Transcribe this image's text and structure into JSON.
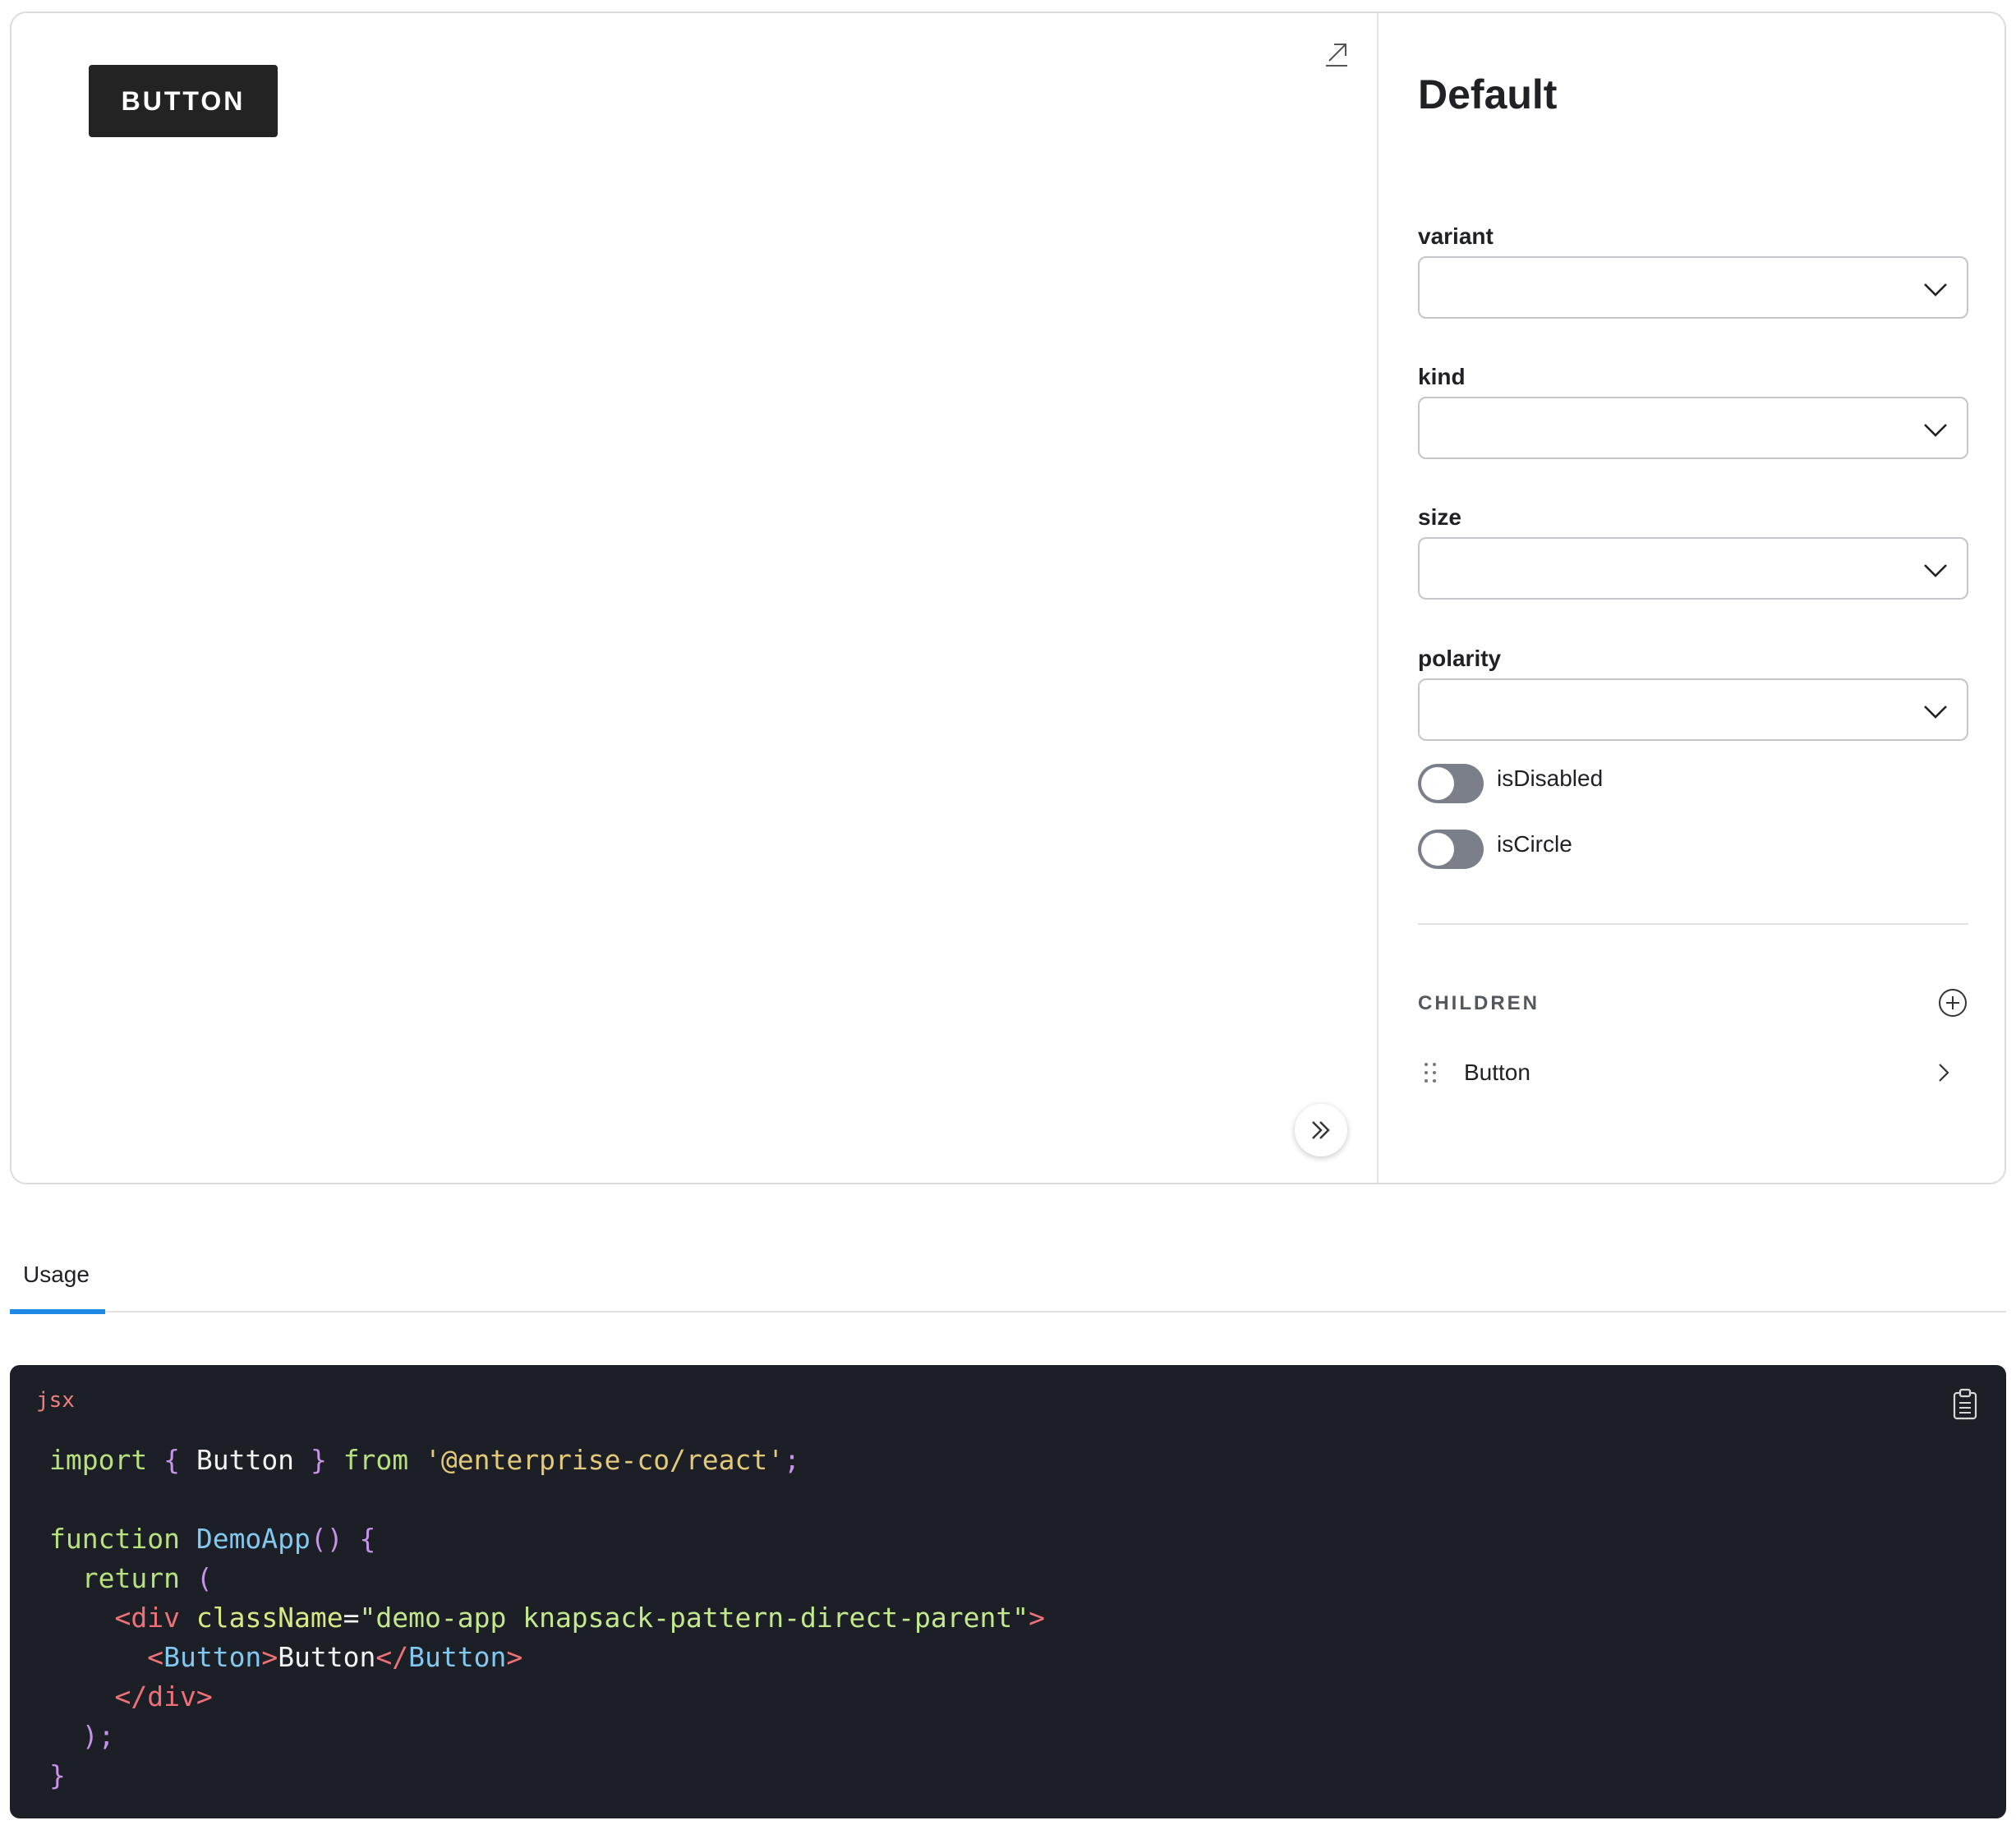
{
  "canvas": {
    "demo_button_label": "BUTTON"
  },
  "controls": {
    "title": "Default",
    "fields": [
      {
        "label": "variant",
        "value": ""
      },
      {
        "label": "kind",
        "value": ""
      },
      {
        "label": "size",
        "value": ""
      },
      {
        "label": "polarity",
        "value": ""
      }
    ],
    "toggles": [
      {
        "label": "isDisabled",
        "checked": false
      },
      {
        "label": "isCircle",
        "checked": false
      }
    ],
    "children_heading": "CHILDREN",
    "children": [
      {
        "label": "Button"
      }
    ]
  },
  "tabs": [
    {
      "label": "Usage",
      "active": true
    }
  ],
  "code": {
    "language": "jsx",
    "lines": [
      "import { Button } from '@enterprise-co/react';",
      "",
      "function DemoApp() {",
      "  return (",
      "    <div className=\"demo-app knapsack-pattern-direct-parent\">",
      "      <Button>Button</Button>",
      "    </div>",
      "  );",
      "}"
    ]
  },
  "colors": {
    "accent": "#1e88e5",
    "demo_button_bg": "#232323",
    "code_bg": "#1c1f26",
    "toggle_off": "#7b7f89"
  },
  "icons": [
    "open-in-new-tab-icon",
    "double-chevron-right-icon",
    "chevron-down-icon",
    "plus-circle-icon",
    "drag-handle-icon",
    "chevron-right-icon",
    "clipboard-icon"
  ]
}
